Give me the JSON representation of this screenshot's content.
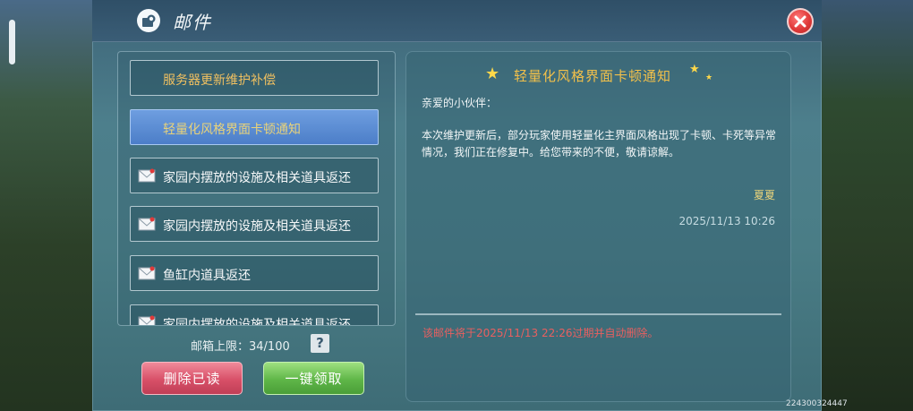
{
  "header": {
    "title": "邮件"
  },
  "mail_list": [
    {
      "label": "服务器更新维护补偿",
      "type": "system",
      "selected": false
    },
    {
      "label": "轻量化风格界面卡顿通知",
      "type": "system",
      "selected": true
    },
    {
      "label": "家园内摆放的设施及相关道具返还",
      "type": "normal",
      "selected": false
    },
    {
      "label": "家园内摆放的设施及相关道具返还",
      "type": "normal",
      "selected": false
    },
    {
      "label": "鱼缸内道具返还",
      "type": "normal",
      "selected": false
    },
    {
      "label": "家园内摆放的设施及相关道具返还",
      "type": "normal",
      "selected": false
    }
  ],
  "footer": {
    "capacity_label": "邮箱上限：34/100",
    "help_label": "?",
    "delete_read_label": "删除已读",
    "claim_all_label": "一键领取"
  },
  "mail_detail": {
    "title": "轻量化风格界面卡顿通知",
    "greeting": "亲爱的小伙伴：",
    "body": "本次维护更新后，部分玩家使用轻量化主界面风格出现了卡顿、卡死等异常情况，我们正在修复中。给您带来的不便，敬请谅解。",
    "signature": "夏夏",
    "date": "2025/11/13 10:26",
    "expiry_notice": "该邮件将于2025/11/13 22:26过期并自动删除。"
  },
  "uid": "224300324447",
  "colors": {
    "system_title": "#f0c060",
    "expiry": "#e86060",
    "selected": "#5a8cd4"
  }
}
